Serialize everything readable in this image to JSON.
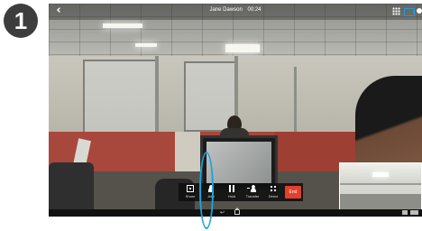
{
  "step": {
    "number": "1"
  },
  "call": {
    "contact_name": "Jane Dawson",
    "duration": "00:24"
  },
  "toolbar": {
    "share_label": "Share",
    "add_label": "Add",
    "hold_label": "Hold",
    "transfer_label": "Transfer",
    "direct_label": "Direct",
    "end_label": "End"
  },
  "colors": {
    "end_button": "#e2402a",
    "highlight": "#1aa3dd",
    "step_badge": "#3d3d3d",
    "camera_icon": "#1e9be0"
  },
  "icons": {
    "top_left": "back-chevron-icon",
    "top_right": [
      "grid-icon",
      "camera-icon",
      "dot-icon"
    ],
    "navigation": [
      "back-arrow-icon",
      "home-icon"
    ]
  }
}
